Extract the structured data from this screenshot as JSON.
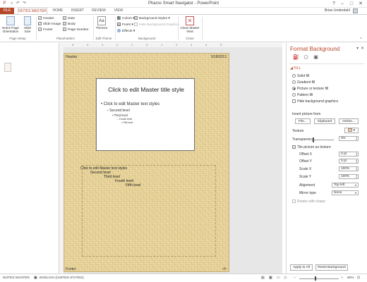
{
  "window": {
    "title": "Pharos Smart Navigator - PowerPoint",
    "user": "Brian Underdahl"
  },
  "tabs": [
    "FILE",
    "NOTES MASTER",
    "HOME",
    "INSERT",
    "REVIEW",
    "VIEW"
  ],
  "ribbon": {
    "page_setup": {
      "notes_orientation": "Notes Page Orientation",
      "slide_size": "Slide Size",
      "group_label": "Page Setup"
    },
    "placeholders": {
      "header": "Header",
      "slide_image": "Slide Image",
      "footer": "Footer",
      "date": "Date",
      "body": "Body",
      "page_number": "Page Number",
      "group_label": "Placeholders"
    },
    "edit_theme": {
      "themes": "Themes",
      "group_label": "Edit Theme"
    },
    "background": {
      "colors": "Colors",
      "fonts": "Fonts",
      "effects": "Effects",
      "background_styles": "Background Styles",
      "hide_graphics": "Hide Background Graphics",
      "group_label": "Background"
    },
    "close": {
      "label": "Close Master View",
      "group_label": "Close"
    }
  },
  "page": {
    "header": "Header",
    "date": "3/18/2013",
    "footer": "Footer",
    "page_number": "‹#›",
    "slide_title": "Click to edit Master title style",
    "slide_levels": [
      "Click to edit Master text styles",
      "Second level",
      "Third level",
      "Fourth level",
      "Fifth level"
    ],
    "notes_levels": [
      "Click to edit Master text styles",
      "Second level",
      "Third level",
      "Fourth level",
      "Fifth level"
    ]
  },
  "pane": {
    "title": "Format Background",
    "fill_label": "FILL",
    "options": [
      "Solid fill",
      "Gradient fill",
      "Picture or texture fill",
      "Pattern fill"
    ],
    "hide_graphics": "Hide background graphics",
    "insert_from": "Insert picture from",
    "file_btn": "File...",
    "clipboard_btn": "Clipboard",
    "online_btn": "Online...",
    "texture_label": "Texture",
    "transparency_label": "Transparency",
    "transparency_value": "0%",
    "tile_label": "Tile picture as texture",
    "offset_x_label": "Offset X",
    "offset_x": "0 pt",
    "offset_y_label": "Offset Y",
    "offset_y": "0 pt",
    "scale_x_label": "Scale X",
    "scale_x": "100%",
    "scale_y_label": "Scale Y",
    "scale_y": "100%",
    "alignment_label": "Alignment",
    "alignment": "Top left",
    "mirror_label": "Mirror type",
    "mirror": "None",
    "rotate_label": "Rotate with shape",
    "apply_all": "Apply to All",
    "reset": "Reset Background"
  },
  "status": {
    "mode": "NOTES MASTER",
    "language": "ENGLISH (UNITED STATES)",
    "zoom": "60%"
  },
  "colors": {
    "accent": "#b7472a",
    "parchment": "#e8d49b"
  }
}
